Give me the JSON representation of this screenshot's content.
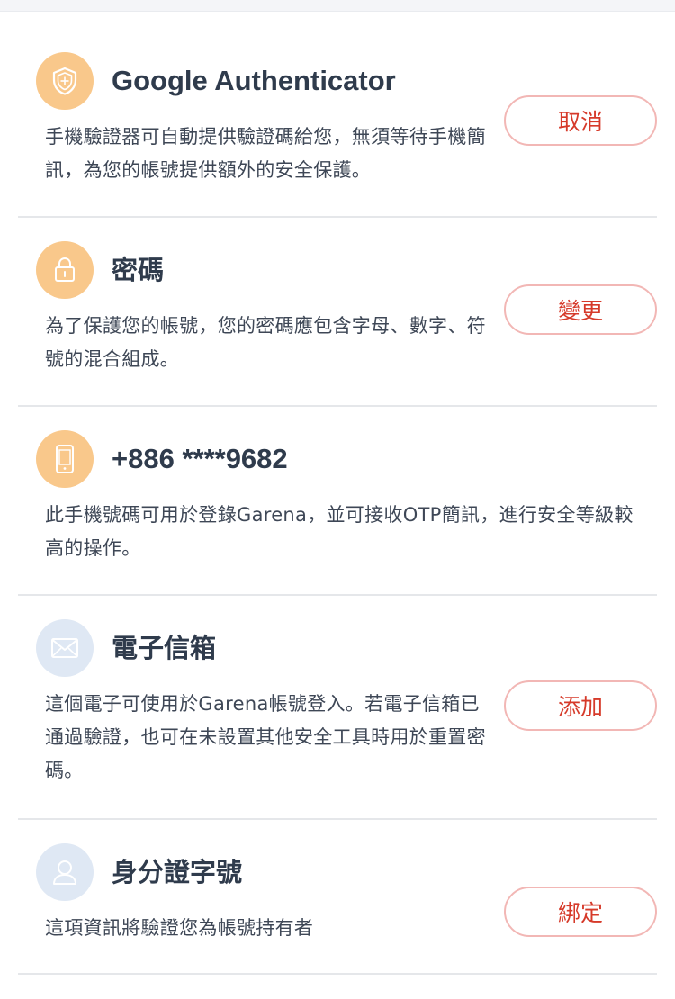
{
  "items": [
    {
      "title": "Google Authenticator",
      "description": "手機驗證器可自動提供驗證碼給您，無須等待手機簡訊，為您的帳號提供額外的安全保護。",
      "button": "取消",
      "icon": "shield-icon"
    },
    {
      "title": "密碼",
      "description": "為了保護您的帳號，您的密碼應包含字母、數字、符號的混合組成。",
      "button": "變更",
      "icon": "lock-icon"
    },
    {
      "title": "+886 ****9682",
      "description": "此手機號碼可用於登錄Garena，並可接收OTP簡訊，進行安全等級較高的操作。",
      "icon": "phone-icon"
    },
    {
      "title": "電子信箱",
      "description": "這個電子可使用於Garena帳號登入。若電子信箱已通過驗證，也可在未設置其他安全工具時用於重置密碼。",
      "button": "添加",
      "icon": "mail-icon"
    },
    {
      "title": "身分證字號",
      "description": "這項資訊將驗證您為帳號持有者",
      "button": "綁定",
      "icon": "user-icon"
    }
  ],
  "colors": {
    "accent_red": "#d63a2a",
    "button_border": "#f2b7b5",
    "icon_orange": "#f9c88b",
    "icon_blue": "#dfe8f4"
  }
}
